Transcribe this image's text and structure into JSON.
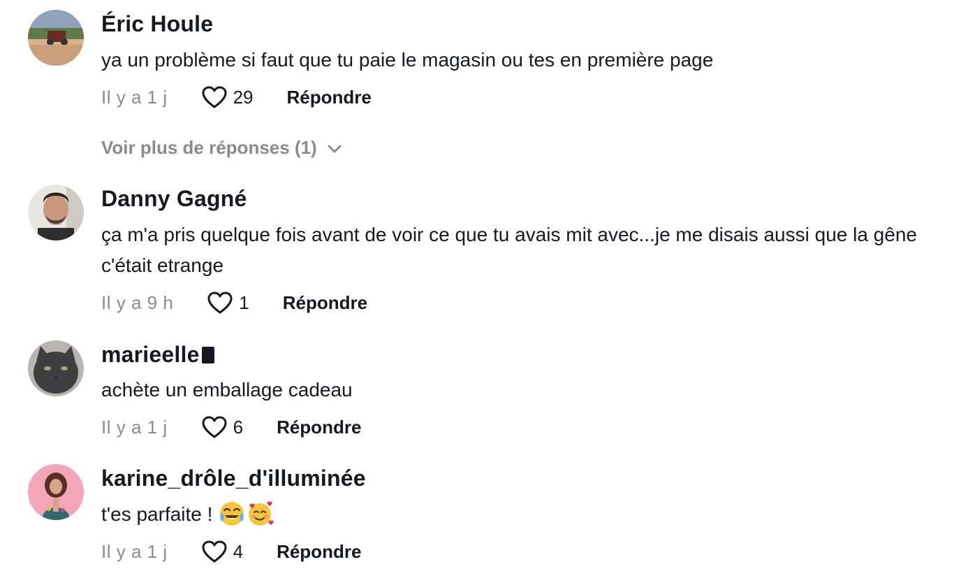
{
  "comments": [
    {
      "username": "Éric Houle",
      "text": "ya un problème si faut que tu paie le magasin ou tes en première page",
      "time": "Il y a 1 j",
      "likes": "29",
      "reply_label": "Répondre",
      "more_replies": "Voir plus de réponses (1)"
    },
    {
      "username": "Danny Gagné",
      "text": "ça m'a pris quelque fois avant de voir ce que tu avais mit avec...je me disais aussi que la gêne c'était etrange",
      "time": "Il y a 9 h",
      "likes": "1",
      "reply_label": "Répondre"
    },
    {
      "username": "marieelle",
      "text": "achète un emballage cadeau",
      "time": "Il y a 1 j",
      "likes": "6",
      "reply_label": "Répondre"
    },
    {
      "username": "karine_drôle_d'illuminée",
      "text": "t'es parfaite ! ",
      "time": "Il y a 1 j",
      "likes": "4",
      "reply_label": "Répondre"
    }
  ],
  "icons": {
    "like": "heart-outline-icon",
    "expand": "chevron-down-icon",
    "emojis": [
      "tears-of-joy-emoji",
      "smiling-face-with-hearts-emoji"
    ]
  },
  "colors": {
    "primary_text": "#161823",
    "secondary_text": "#8a8b91",
    "background": "#ffffff"
  }
}
